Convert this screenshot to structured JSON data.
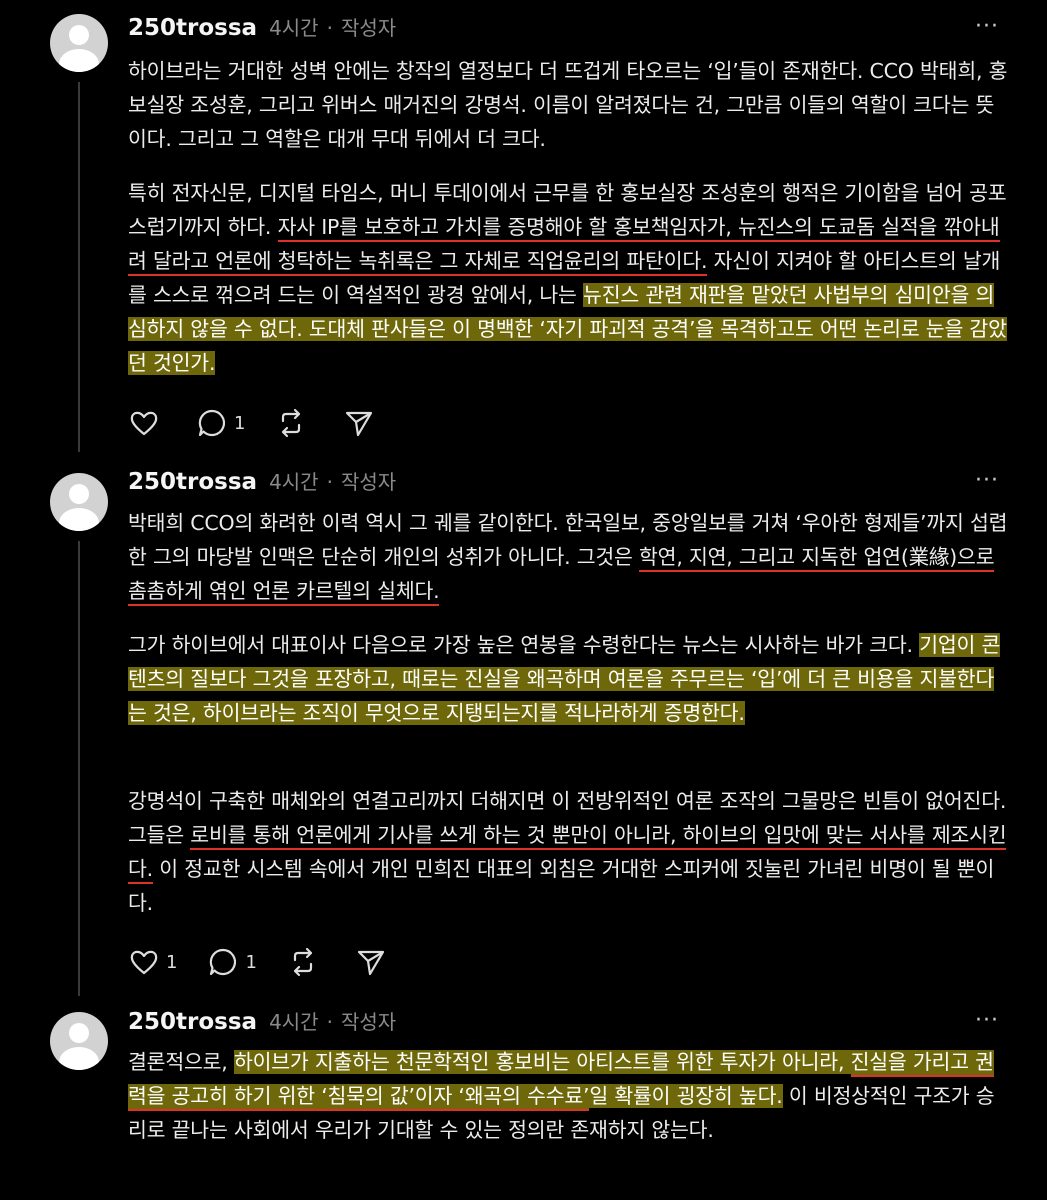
{
  "posts": [
    {
      "username": "250trossa",
      "time": "4시간",
      "tag": "작성자",
      "more": "···",
      "paragraphs": [
        [
          {
            "t": "하이브라는 거대한 성벽 안에는 창작의 열정보다 더 뜨겁게 타오르는 ‘입’들이 존재한다. CCO 박태희, 홍보실장 조성훈, 그리고 위버스 매거진의 강명석. 이름이 알려졌다는 건, 그만큼 이들의 역할이 크다는 뜻이다. 그리고 그 역할은 대개 무대 뒤에서 더 크다."
          }
        ],
        [
          {
            "t": "특히 전자신문, 디지털 타임스, 머니 투데이에서 근무를 한 홍보실장 조성훈의 행적은 기이함을 넘어 공포스럽기까지 하다. "
          },
          {
            "t": "자사 IP를 보호하고 가치를 증명해야 할 홍보책임자가, 뉴진스의 도쿄돔 실적을 깎아내려 달라고 언론에 청탁하는 녹취록은 그 자체로 직업윤리의 파탄이다.",
            "s": "ul"
          },
          {
            "t": " 자신이 지켜야 할 아티스트의 날개를 스스로 꺾으려 드는 이 역설적인 광경 앞에서, 나는 "
          },
          {
            "t": "뉴진스 관련 재판을 맡았던 사법부의 심미안을 의심하지 않을 수 없다. 도대체 판사들은 이 명백한 ‘자기 파괴적 공격’을 목격하고도 어떤 논리로 눈을 감았던 것인가.",
            "s": "hl"
          }
        ]
      ],
      "actions": {
        "likes": "",
        "comments": "1",
        "reposts": "",
        "shares": ""
      }
    },
    {
      "username": "250trossa",
      "time": "4시간",
      "tag": "작성자",
      "more": "···",
      "paragraphs": [
        [
          {
            "t": "박태희 CCO의 화려한 이력 역시 그 궤를 같이한다. 한국일보, 중앙일보를 거쳐 ‘우아한 형제들’까지 섭렵한 그의 마당발 인맥은 단순히 개인의 성취가 아니다. 그것은 "
          },
          {
            "t": "학연, 지연, 그리고 지독한 업연(業緣)으로 촘촘하게 엮인 언론 카르텔의 실체다.",
            "s": "ul"
          }
        ],
        [
          {
            "t": "그가 하이브에서 대표이사 다음으로 가장 높은 연봉을 수령한다는 뉴스는 시사하는 바가 크다. "
          },
          {
            "t": "기업이 콘텐츠의 질보다 그것을 포장하고, 때로는 진실을 왜곡하며 여론을 주무르는 ‘입’에 더 큰 비용을 지불한다는 것은, 하이브라는 조직이 무엇으로 지탱되는지를 적나라하게 증명한다.",
            "s": "hl"
          }
        ],
        [
          {
            "t": "강명석이 구축한 매체와의 연결고리까지 더해지면 이 전방위적인 여론 조작의 그물망은 빈틈이 없어진다. 그들은 "
          },
          {
            "t": "로비를 통해 언론에게 기사를 쓰게 하는 것 뿐만이 아니라, 하이브의 입맛에 맞는 서사를 제조시킨다.",
            "s": "ul"
          },
          {
            "t": " 이 정교한 시스템 속에서 개인 민희진 대표의 외침은 거대한 스피커에 짓눌린 가녀린 비명이 될 뿐이다."
          }
        ]
      ],
      "actions": {
        "likes": "1",
        "comments": "1",
        "reposts": "",
        "shares": ""
      }
    },
    {
      "username": "250trossa",
      "time": "4시간",
      "tag": "작성자",
      "more": "···",
      "paragraphs": [
        [
          {
            "t": "결론적으로, "
          },
          {
            "t": "하이브가 지출하는 천문학적인 홍보비는 아티스트를 위한 투자가 아니라, ",
            "s": "hl"
          },
          {
            "t": "진실을 가리고 권력을 공고히 하기 위한 ‘침묵의 값’이자 ‘왜곡의 수수료’",
            "s": "hlul"
          },
          {
            "t": "일 확률이 굉장히 높다.",
            "s": "hl"
          },
          {
            "t": " 이 비정상적인 구조가 승리로 끝나는 사회에서 우리가 기대할 수 있는 정의란 존재하지 않는다."
          }
        ]
      ]
    }
  ]
}
